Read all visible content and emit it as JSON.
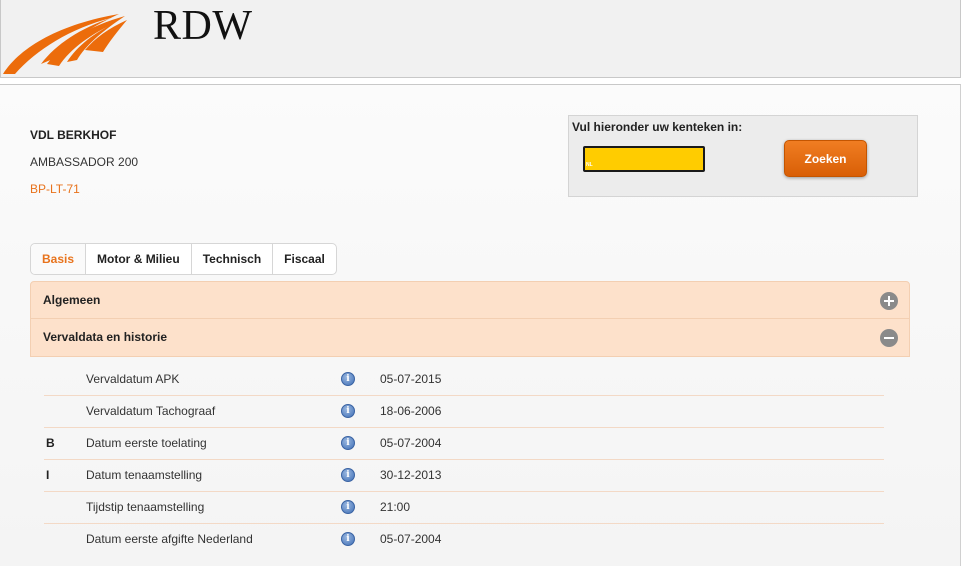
{
  "brand": {
    "name": "RDW",
    "color": "#e8731c"
  },
  "vehicle": {
    "name": "VDL BERKHOF",
    "model": "AMBASSADOR 200",
    "plate": "BP-LT-71"
  },
  "search": {
    "label": "Vul hieronder uw kenteken in:",
    "plate_country": "NL",
    "value": "",
    "button_label": "Zoeken"
  },
  "tabs": [
    {
      "label": "Basis",
      "active": true
    },
    {
      "label": "Motor & Milieu",
      "active": false
    },
    {
      "label": "Technisch",
      "active": false
    },
    {
      "label": "Fiscaal",
      "active": false
    }
  ],
  "sections": [
    {
      "title": "Algemeen",
      "expanded": false,
      "icon": "plus-circle-icon"
    },
    {
      "title": "Vervaldata en historie",
      "expanded": true,
      "icon": "minus-circle-icon"
    }
  ],
  "rows": [
    {
      "code": "",
      "label": "Vervaldatum APK",
      "value": "05-07-2015"
    },
    {
      "code": "",
      "label": "Vervaldatum Tachograaf",
      "value": "18-06-2006"
    },
    {
      "code": "B",
      "label": "Datum eerste toelating",
      "value": "05-07-2004"
    },
    {
      "code": "I",
      "label": "Datum tenaamstelling",
      "value": "30-12-2013"
    },
    {
      "code": "",
      "label": "Tijdstip tenaamstelling",
      "value": "21:00"
    },
    {
      "code": "",
      "label": "Datum eerste afgifte Nederland",
      "value": "05-07-2004"
    }
  ],
  "info_icon_glyph": "i"
}
